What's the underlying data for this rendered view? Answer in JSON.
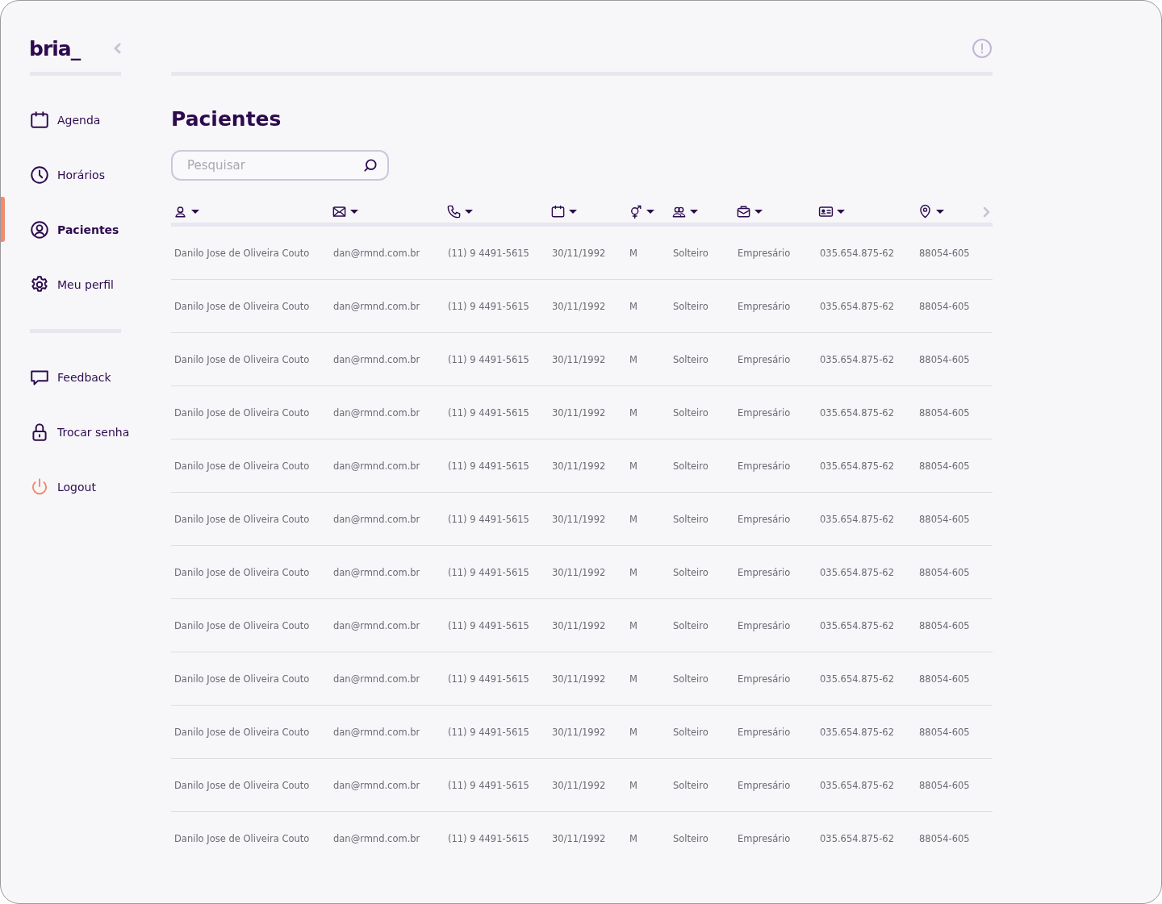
{
  "sidebar": {
    "logo": "bria_",
    "items": [
      {
        "label": "Agenda",
        "kind": "calendar",
        "selected": false
      },
      {
        "label": "Horários",
        "kind": "clock",
        "selected": false
      },
      {
        "label": "Pacientes",
        "kind": "user",
        "selected": true
      },
      {
        "label": "Meu perfil",
        "kind": "gear",
        "selected": false
      }
    ],
    "secondary_items": [
      {
        "label": "Feedback",
        "kind": "chat"
      },
      {
        "label": "Trocar senha",
        "kind": "lock"
      },
      {
        "label": "Logout",
        "kind": "power"
      }
    ]
  },
  "page": {
    "title": "Pacientes",
    "search": {
      "placeholder": "Pesquisar"
    }
  },
  "table": {
    "columns": [
      {
        "kind": "person"
      },
      {
        "kind": "mail"
      },
      {
        "kind": "phone"
      },
      {
        "kind": "calendar"
      },
      {
        "kind": "gender"
      },
      {
        "kind": "people"
      },
      {
        "kind": "briefcase"
      },
      {
        "kind": "idcard"
      },
      {
        "kind": "pin"
      }
    ],
    "rows": [
      [
        "Danilo Jose de Oliveira Couto",
        "dan@rmnd.com.br",
        "(11) 9 4491-5615",
        "30/11/1992",
        "M",
        "Solteiro",
        "Empresário",
        "035.654.875-62",
        "88054-605"
      ],
      [
        "Danilo Jose de Oliveira Couto",
        "dan@rmnd.com.br",
        "(11) 9 4491-5615",
        "30/11/1992",
        "M",
        "Solteiro",
        "Empresário",
        "035.654.875-62",
        "88054-605"
      ],
      [
        "Danilo Jose de Oliveira Couto",
        "dan@rmnd.com.br",
        "(11) 9 4491-5615",
        "30/11/1992",
        "M",
        "Solteiro",
        "Empresário",
        "035.654.875-62",
        "88054-605"
      ],
      [
        "Danilo Jose de Oliveira Couto",
        "dan@rmnd.com.br",
        "(11) 9 4491-5615",
        "30/11/1992",
        "M",
        "Solteiro",
        "Empresário",
        "035.654.875-62",
        "88054-605"
      ],
      [
        "Danilo Jose de Oliveira Couto",
        "dan@rmnd.com.br",
        "(11) 9 4491-5615",
        "30/11/1992",
        "M",
        "Solteiro",
        "Empresário",
        "035.654.875-62",
        "88054-605"
      ],
      [
        "Danilo Jose de Oliveira Couto",
        "dan@rmnd.com.br",
        "(11) 9 4491-5615",
        "30/11/1992",
        "M",
        "Solteiro",
        "Empresário",
        "035.654.875-62",
        "88054-605"
      ],
      [
        "Danilo Jose de Oliveira Couto",
        "dan@rmnd.com.br",
        "(11) 9 4491-5615",
        "30/11/1992",
        "M",
        "Solteiro",
        "Empresário",
        "035.654.875-62",
        "88054-605"
      ],
      [
        "Danilo Jose de Oliveira Couto",
        "dan@rmnd.com.br",
        "(11) 9 4491-5615",
        "30/11/1992",
        "M",
        "Solteiro",
        "Empresário",
        "035.654.875-62",
        "88054-605"
      ],
      [
        "Danilo Jose de Oliveira Couto",
        "dan@rmnd.com.br",
        "(11) 9 4491-5615",
        "30/11/1992",
        "M",
        "Solteiro",
        "Empresário",
        "035.654.875-62",
        "88054-605"
      ],
      [
        "Danilo Jose de Oliveira Couto",
        "dan@rmnd.com.br",
        "(11) 9 4491-5615",
        "30/11/1992",
        "M",
        "Solteiro",
        "Empresário",
        "035.654.875-62",
        "88054-605"
      ],
      [
        "Danilo Jose de Oliveira Couto",
        "dan@rmnd.com.br",
        "(11) 9 4491-5615",
        "30/11/1992",
        "M",
        "Solteiro",
        "Empresário",
        "035.654.875-62",
        "88054-605"
      ],
      [
        "Danilo Jose de Oliveira Couto",
        "dan@rmnd.com.br",
        "(11) 9 4491-5615",
        "30/11/1992",
        "M",
        "Solteiro",
        "Empresário",
        "035.654.875-62",
        "88054-605"
      ]
    ]
  }
}
